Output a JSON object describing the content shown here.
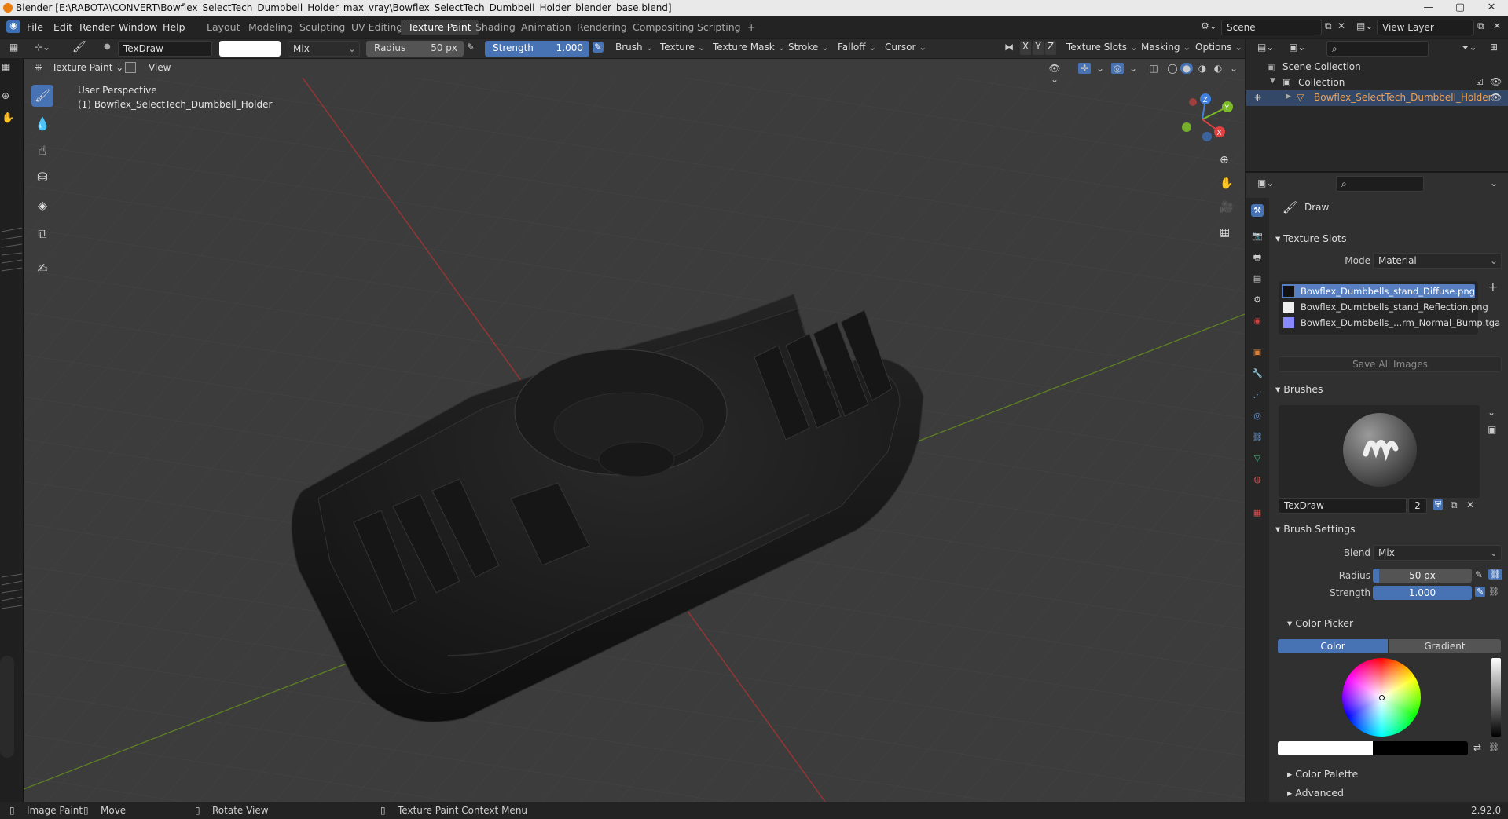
{
  "window": {
    "title": "Blender [E:\\RABOTA\\CONVERT\\Bowflex_SelectTech_Dumbbell_Holder_max_vray\\Bowflex_SelectTech_Dumbbell_Holder_blender_base.blend]",
    "minimize": "—",
    "maximize": "▢",
    "close": "✕"
  },
  "menu": [
    "File",
    "Edit",
    "Render",
    "Window",
    "Help"
  ],
  "workspaces": [
    "Layout",
    "Modeling",
    "Sculpting",
    "UV Editing",
    "Texture Paint",
    "Shading",
    "Animation",
    "Rendering",
    "Compositing",
    "Scripting"
  ],
  "workspace_add": "+",
  "scene": {
    "label": "Scene",
    "view_layer": "View Layer"
  },
  "tool_header": {
    "brush_name": "TexDraw",
    "blend": "Mix",
    "radius_label": "Radius",
    "radius_value": "50 px",
    "strength_label": "Strength",
    "strength_value": "1.000",
    "menus": [
      "Brush",
      "Texture",
      "Texture Mask",
      "Stroke",
      "Falloff",
      "Cursor"
    ],
    "axes": [
      "X",
      "Y",
      "Z"
    ],
    "right_menus": [
      "Texture Slots",
      "Masking",
      "Options"
    ]
  },
  "viewport_header": {
    "mode": "Texture Paint",
    "view": "View"
  },
  "viewport": {
    "perspective": "User Perspective",
    "object": "(1) Bowflex_SelectTech_Dumbbell_Holder"
  },
  "gizmo": {
    "x": "X",
    "y": "Y",
    "z": "Z"
  },
  "outliner": {
    "scene_collection": "Scene Collection",
    "collection": "Collection",
    "object": "Bowflex_SelectTech_Dumbbell_Holder"
  },
  "properties": {
    "tool_name": "Draw",
    "texture_slots": {
      "title": "Texture Slots",
      "mode_label": "Mode",
      "mode_value": "Material",
      "slots": [
        "Bowflex_Dumbbells_stand_Diffuse.png",
        "Bowflex_Dumbbells_stand_Reflection.png",
        "Bowflex_Dumbbells_...rm_Normal_Bump.tga"
      ],
      "save_all": "Save All Images"
    },
    "brushes": {
      "title": "Brushes",
      "brush_name": "TexDraw",
      "users": "2"
    },
    "brush_settings": {
      "title": "Brush Settings",
      "blend_label": "Blend",
      "blend_value": "Mix",
      "radius_label": "Radius",
      "radius_value": "50 px",
      "strength_label": "Strength",
      "strength_value": "1.000"
    },
    "color_picker": {
      "title": "Color Picker",
      "tab_color": "Color",
      "tab_gradient": "Gradient"
    },
    "color_palette": "Color Palette",
    "advanced": "Advanced"
  },
  "status": {
    "image_paint": "Image Paint",
    "move": "Move",
    "rotate": "Rotate View",
    "context": "Texture Paint Context Menu",
    "version": "2.92.0"
  },
  "colors": {
    "accent": "#4772b3",
    "active_slot": "#5680c2",
    "selected_obj": "#f0a050"
  }
}
